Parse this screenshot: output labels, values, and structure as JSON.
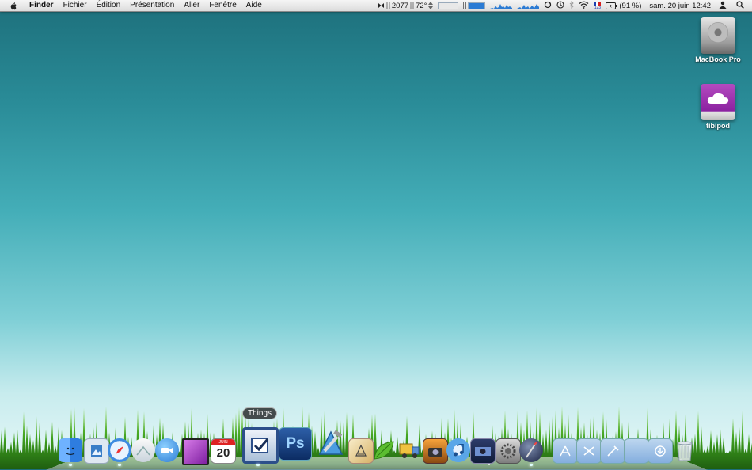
{
  "menubar": {
    "app_name": "Finder",
    "menus": [
      "Fichier",
      "Édition",
      "Présentation",
      "Aller",
      "Fenêtre",
      "Aide"
    ],
    "status": {
      "rpm": "2077",
      "temperature": "72°",
      "flag_badge": "123",
      "battery": "(91 %)",
      "clock": "sam. 20 juin 12:42"
    }
  },
  "desktop": {
    "icons": [
      {
        "label": "MacBook Pro",
        "icon": "hard-drive-icon"
      },
      {
        "label": "tibipod",
        "icon": "idisk-icon"
      }
    ]
  },
  "dock": {
    "tooltip": "Things",
    "calendar_month": "JUIN",
    "calendar_day": "20",
    "ps_label": "Ps",
    "apps": [
      {
        "icon": "finder-icon",
        "running": true
      },
      {
        "icon": "preview-icon",
        "running": false
      },
      {
        "icon": "safari-icon",
        "running": true
      },
      {
        "icon": "mail-icon",
        "running": false
      },
      {
        "icon": "ichat-icon",
        "running": false
      },
      {
        "icon": "sketch-icon",
        "running": false
      },
      {
        "icon": "ical-icon",
        "running": false
      },
      {
        "icon": "things-icon",
        "running": true
      },
      {
        "icon": "photoshop-icon",
        "running": false
      },
      {
        "icon": "xcode-icon",
        "running": false
      },
      {
        "icon": "pages-icon",
        "running": false
      },
      {
        "icon": "leaf-icon",
        "running": false
      },
      {
        "icon": "transmit-icon",
        "running": false
      },
      {
        "icon": "iphoto-icon",
        "running": false
      },
      {
        "icon": "itunes-icon",
        "running": false
      },
      {
        "icon": "photo-booth-icon",
        "running": false
      },
      {
        "icon": "system-preferences-icon",
        "running": false
      },
      {
        "icon": "pixelmator-icon",
        "running": true
      },
      {
        "icon": "applications-folder-icon",
        "running": false
      },
      {
        "icon": "utilities-folder-icon",
        "running": false
      },
      {
        "icon": "developer-folder-icon",
        "running": false
      },
      {
        "icon": "documents-folder-icon",
        "running": false
      },
      {
        "icon": "downloads-folder-icon",
        "running": false
      },
      {
        "icon": "trash-icon",
        "running": false
      }
    ]
  },
  "colors": {
    "desktop_top": "#1d6f7b",
    "desktop_bottom": "#e8f8f8",
    "grass": "#3fa11f",
    "accent_blue": "#2b7bd4"
  }
}
